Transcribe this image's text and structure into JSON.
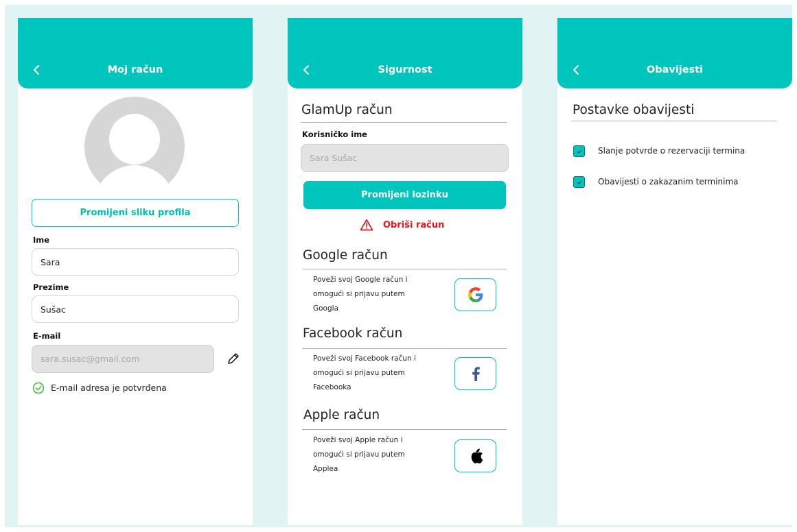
{
  "screens": {
    "account": {
      "title": "Moj račun",
      "change_photo_label": "Promijeni sliku profila",
      "first_name": {
        "label": "Ime",
        "value": "Sara"
      },
      "last_name": {
        "label": "Prezime",
        "value": "Sušac"
      },
      "email": {
        "label": "E-mail",
        "value": "sara.susac@gmail.com"
      },
      "email_verified_text": "E-mail adresa je potvrđena"
    },
    "security": {
      "title": "Sigurnost",
      "glamup_section": "GlamUp račun",
      "username": {
        "label": "Korisničko ime",
        "value": "Sara Sušac"
      },
      "change_password_label": "Promijeni lozinku",
      "delete_account_label": "Obriši račun",
      "google": {
        "title": "Google račun",
        "lines": [
          "Poveži svoj Google račun i",
          "omogući si prijavu putem",
          "Googla"
        ]
      },
      "facebook": {
        "title": "Facebook račun",
        "lines": [
          "Poveži svoj Facebook račun i",
          "omogući si prijavu putem",
          "Facebooka"
        ]
      },
      "apple": {
        "title": "Apple račun",
        "lines": [
          "Poveži svoj Apple račun i",
          "omogući si prijavu putem",
          "Applea"
        ]
      }
    },
    "notifications": {
      "title": "Obavijesti",
      "section_title": "Postavke obavijesti",
      "options": [
        {
          "label": "Slanje potvrde o rezervaciji termina",
          "checked": true
        },
        {
          "label": "Obavijesti o zakazanim terminima",
          "checked": true
        }
      ]
    }
  },
  "colors": {
    "accent": "#00c5bd",
    "background": "#e1f4f3",
    "danger": "#e8141a",
    "verified": "#3cc13b",
    "facebook": "#3b5998"
  },
  "icons": [
    "chevron-left-icon",
    "avatar-placeholder-icon",
    "pencil-icon",
    "check-circle-icon",
    "warning-icon",
    "google-icon",
    "facebook-icon",
    "apple-icon",
    "checkbox-icon"
  ]
}
